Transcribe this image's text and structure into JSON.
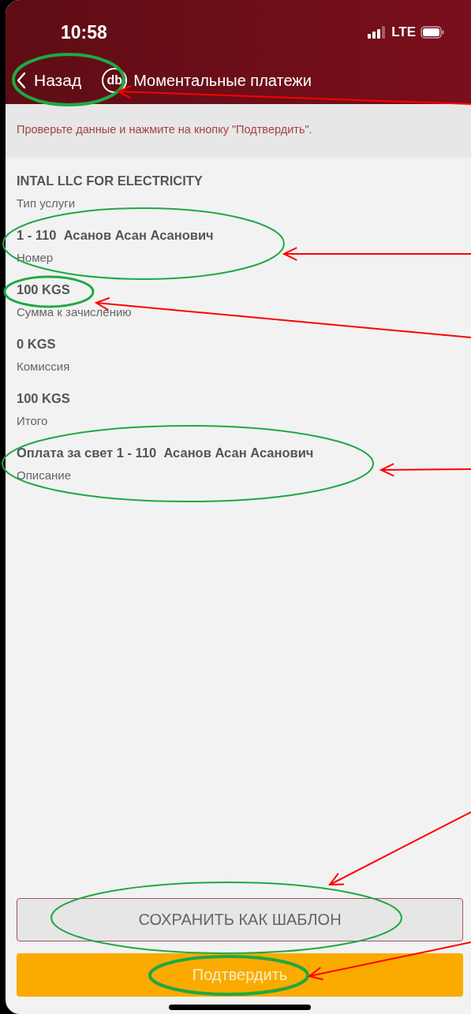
{
  "status_bar": {
    "time": "10:58",
    "network": "LTE"
  },
  "nav": {
    "back": "Назад",
    "logo": "db",
    "title": "Моментальные платежи"
  },
  "notice": "Проверьте данные и нажмите на кнопку \"Подтвердить\".",
  "fields": [
    {
      "value": "INTAL LLC FOR ELECTRICITY",
      "label": "Тип услуги"
    },
    {
      "value": "1 - 110  Асанов Асан Асанович",
      "label": "Номер"
    },
    {
      "value": "100 KGS",
      "label": "Сумма к зачислению"
    },
    {
      "value": "0 KGS",
      "label": "Комиссия"
    },
    {
      "value": "100 KGS",
      "label": "Итого"
    },
    {
      "value": "Оплата за свет 1 - 110  Асанов Асан Асанович",
      "label": "Описание"
    }
  ],
  "buttons": {
    "save": "СОХРАНИТЬ КАК ШАБЛОН",
    "confirm": "Подтвердить"
  }
}
